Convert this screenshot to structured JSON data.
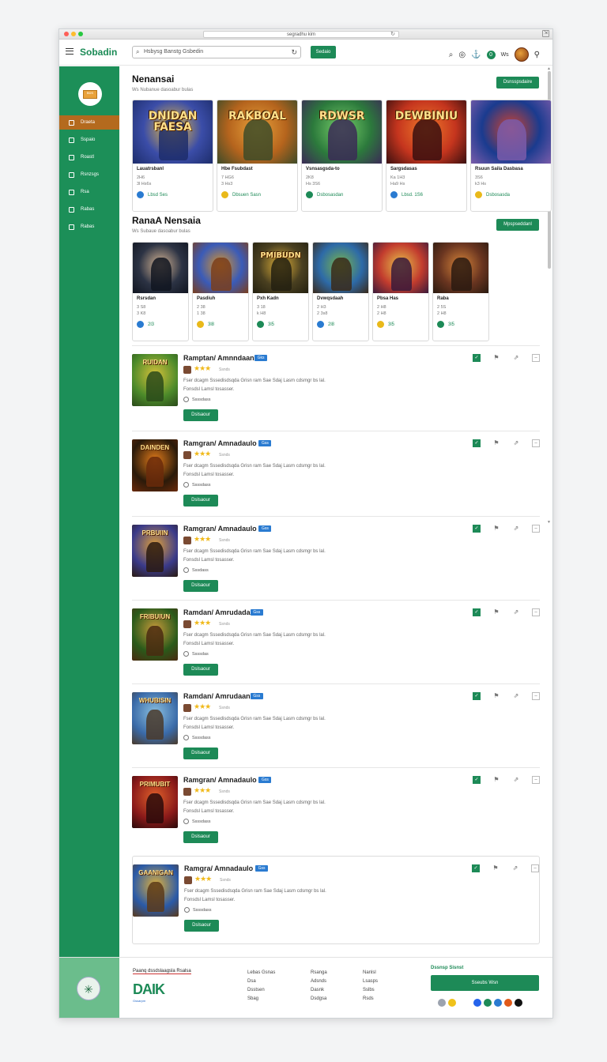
{
  "browser": {
    "url": "segradhu kim"
  },
  "header": {
    "logo": "Sobadin",
    "search_placeholder": "Hsbysg Banstg Gsbedin",
    "search_button": "Sedaio",
    "notif_count": "0",
    "notif_text": "Ws"
  },
  "sidebar": {
    "logo_text": "BDS",
    "items": [
      {
        "label": "Draeta",
        "icon": "home-icon"
      },
      {
        "label": "Sspaio",
        "icon": "bookmark-icon"
      },
      {
        "label": "Roastl",
        "icon": "user-icon"
      },
      {
        "label": "Rsnzsgs",
        "icon": "grid-icon"
      },
      {
        "label": "Rsa",
        "icon": "square-icon"
      },
      {
        "label": "Rabas",
        "icon": "document-icon"
      },
      {
        "label": "Rabas",
        "icon": "circle-icon"
      }
    ]
  },
  "section1": {
    "title": "Nenansai",
    "subtitle": "Ws Nubanue dasoabur bulas",
    "button": "Dsnsspsdaire",
    "cards": [
      {
        "img_text": "DNIDAN FAESA",
        "title": "Lauatrsbanl",
        "meta1": "2H6",
        "meta2": "3l Hs6s",
        "footer": "Lbsd Ses",
        "colors": [
          "#3b4da8",
          "#f1c23c",
          "#1d2d6b"
        ]
      },
      {
        "img_text": "RAKBOAL",
        "title": "Hbe Fsubdast",
        "meta1": "7 HG6",
        "meta2": "3 Hs3",
        "footer": "Dbsuen Sasn",
        "colors": [
          "#b5641d",
          "#e9a23b",
          "#3d4b28"
        ]
      },
      {
        "img_text": "RDWSR",
        "title": "Vsnsasgsda-to",
        "meta1": "2K8",
        "meta2": "Hs 3S6",
        "footer": "Dsbosasdan",
        "colors": [
          "#2c7a3c",
          "#78d06a",
          "#3b2a56"
        ]
      },
      {
        "img_text": "DEWBINIU",
        "title": "Sargsdasas",
        "meta1": "Ka 1H3",
        "meta2": "Ha9 Hs",
        "footer": "Lbsd. 1S6",
        "colors": [
          "#c5351e",
          "#f07b2a",
          "#3a0f0f"
        ]
      },
      {
        "img_text": "",
        "title": "Rsuun Saila Dasbasa",
        "meta1": "3S6",
        "meta2": "k3 Hs",
        "footer": "Dsbosasda",
        "colors": [
          "#1a3b8f",
          "#d3422d",
          "#7a5caa"
        ]
      }
    ]
  },
  "section2": {
    "title": "RanaA Nensaia",
    "subtitle": "Ws Subaue dasoabur bulas",
    "button": "Mpspseddanl",
    "cards": [
      {
        "img_text": "",
        "title": "Rsrsdan",
        "meta1": "3 S8",
        "meta2": "3 K8",
        "footer": "2l3",
        "colors": [
          "#2c3344",
          "#d9b896",
          "#101520"
        ]
      },
      {
        "img_text": "",
        "title": "Pasdiuh",
        "meta1": "2 38",
        "meta2": "1 38",
        "footer": "3l8",
        "colors": [
          "#3a5bb8",
          "#d8942a",
          "#7a3e1c"
        ]
      },
      {
        "img_text": "PMIBUDN",
        "title": "Pxh Kadn",
        "meta1": "3 18",
        "meta2": "k H8",
        "footer": "3l5",
        "colors": [
          "#4a4020",
          "#e0b13a",
          "#232010"
        ]
      },
      {
        "img_text": "",
        "title": "Dvwqsdaah",
        "meta1": "2 H3",
        "meta2": "2 3s8",
        "footer": "2l8",
        "colors": [
          "#2d6aa8",
          "#7ab64a",
          "#3a2a1a"
        ]
      },
      {
        "img_text": "",
        "title": "Pbsa Has",
        "meta1": "2 H8",
        "meta2": "2 H8",
        "footer": "3l5",
        "colors": [
          "#c23c2e",
          "#e7c34b",
          "#3a1a3a"
        ]
      },
      {
        "img_text": "",
        "title": "Raba",
        "meta1": "2 5S",
        "meta2": "2 H8",
        "footer": "3l5",
        "colors": [
          "#6a3520",
          "#d7853a",
          "#2a1a10"
        ]
      }
    ]
  },
  "list": {
    "button_label": "Dslsaour",
    "items": [
      {
        "title": "Ramptan/ Amnndaan",
        "badge": "Gks",
        "stars": "★★★",
        "count": "Ssnds",
        "desc1": "Fser dcagm Sssedisdsqda Grisn ram Sae Sdaj Lasm cdsmgr bs lal.",
        "desc2": "Fonsdsl Lamsl tosasser.",
        "meta": "Ssssdass",
        "img_text": "RUIDAN",
        "colors": [
          "#4c8a2a",
          "#d7c23a",
          "#2a4a1a"
        ]
      },
      {
        "title": "Ramgran/ Amnadaulo",
        "badge": "Gss",
        "stars": "★★★",
        "count": "Ssnds",
        "desc1": "Fser dcagm Sssedisdsqda Grisn ram Sae Sdaj Lasm cdsmgr bs lal.",
        "desc2": "Fonsdsl Lamsl tosasser.",
        "meta": "Ssssdass",
        "img_text": "DAINDEN",
        "colors": [
          "#2a1a0a",
          "#e07a1a",
          "#6a2a0a"
        ]
      },
      {
        "title": "Ramgran/ Amnadaulo",
        "badge": "Gss",
        "stars": "★★★",
        "count": "Ssnds",
        "desc1": "Fser dcagm Sssedisdsqda Grisn ram Sae Sdaj Lasm cdsmgr bs lal.",
        "desc2": "Fonsdsl Lamsl tosasser.",
        "meta": "Sssdass",
        "img_text": "PRBUIIN",
        "colors": [
          "#3a3a8a",
          "#e0a03a",
          "#2a1a10"
        ]
      },
      {
        "title": "Ramdan/ Amrudada",
        "badge": "Gss",
        "stars": "★★★",
        "count": "Ssnds",
        "desc1": "Fser dcagm Sssedisdsqda Grisn ram Sae Sdaj Lasm cdsmgr bs lal.",
        "desc2": "Fonsdsl Lamsl tosasser.",
        "meta": "Ssssdas",
        "img_text": "FRIBUIUN",
        "colors": [
          "#2a5a1a",
          "#c79a3a",
          "#4a2a10"
        ]
      },
      {
        "title": "Ramdan/ Amrudaan",
        "badge": "Gss",
        "stars": "★★★",
        "count": "Ssnds",
        "desc1": "Fser dcagm Sssedisdsqda Grisn ram Sae Sdaj Lasm cdsmgr bs lal.",
        "desc2": "Fonsdsl Lamsl tosasser.",
        "meta": "Ssssdass",
        "img_text": "WHUBISIN",
        "colors": [
          "#3a6aa8",
          "#8ac0e0",
          "#4a3a2a"
        ]
      },
      {
        "title": "Ramgran/ Amnadaulo",
        "badge": "Gss",
        "stars": "★★★",
        "count": "Ssnds",
        "desc1": "Fser dcagm Sssedisdsqda Grisn ram Sae Sdaj Lasm cdsmgr bs lal.",
        "desc2": "Fonsdsl Lamsl tosasser.",
        "meta": "Ssssdass",
        "img_text": "PRIMUBIT",
        "colors": [
          "#8a1a1a",
          "#e0602a",
          "#2a0a0a"
        ]
      },
      {
        "title": "Ramgra/ Amnadaulo",
        "badge": "Gss",
        "stars": "★★★",
        "count": "Ssnds",
        "desc1": "Fser dcagm Sssedisdsqda Grisn ram Sae Sdaj Lasm cdsmgr bs lal.",
        "desc2": "Fonsdsl Lamsl tosasser.",
        "meta": "Ssssdass",
        "img_text": "GAANIGAN",
        "colors": [
          "#2a5aa8",
          "#e0b03a",
          "#5a3a1a"
        ]
      }
    ]
  },
  "footer": {
    "tagline": "Paanq dssdslaagsla Rsalsa",
    "brand": "DAIK",
    "brand_sub": "Gssarpm",
    "col1": [
      "Lebas Gsnas",
      "Dsa",
      "Dsstsen",
      "Sbag"
    ],
    "col2": [
      "Rsanga",
      "Adsnds",
      "Dasnk",
      "Dsdgsa"
    ],
    "col3": [
      "Nanlsl",
      "Lsasps",
      "Sslbs",
      "Rsds"
    ],
    "sub_title": "Dssnsp Sisnst",
    "sub_button": "Sseubs Wsn",
    "social_colors": [
      "#9ca3af",
      "#f0c21a",
      "#2563eb",
      "#1d8a57",
      "#2a7bd1",
      "#e05a1a",
      "#111111"
    ]
  }
}
